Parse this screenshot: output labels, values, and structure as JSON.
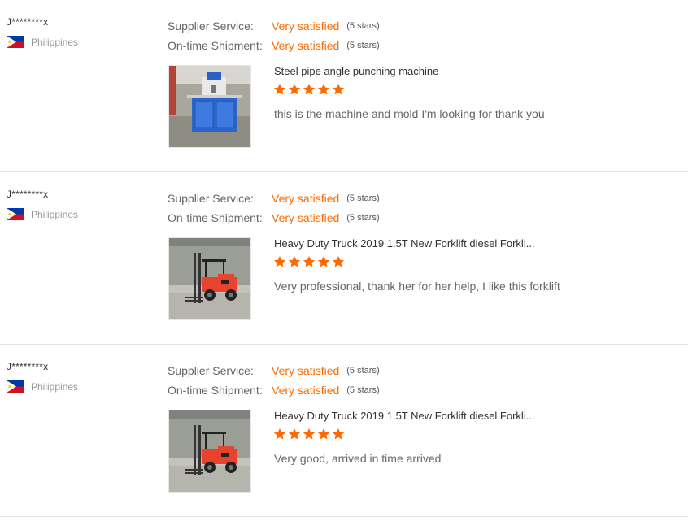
{
  "reviews": [
    {
      "user": "J********x",
      "country": "Philippines",
      "supplier_service_label": "Supplier Service:",
      "supplier_service_value": "Very satisfied",
      "supplier_service_stars": "(5 stars)",
      "shipment_label": "On-time Shipment:",
      "shipment_value": "Very satisfied",
      "shipment_stars": "(5 stars)",
      "product_title": "Steel pipe angle punching machine",
      "rating": 5,
      "comment": "this is the machine and mold I'm looking for thank you",
      "image": "punching-machine"
    },
    {
      "user": "J********x",
      "country": "Philippines",
      "supplier_service_label": "Supplier Service:",
      "supplier_service_value": "Very satisfied",
      "supplier_service_stars": "(5 stars)",
      "shipment_label": "On-time Shipment:",
      "shipment_value": "Very satisfied",
      "shipment_stars": "(5 stars)",
      "product_title": "Heavy Duty Truck 2019 1.5T New Forklift diesel Forkli...",
      "rating": 5,
      "comment": "Very professional, thank her for her help, I like this forklift",
      "image": "forklift"
    },
    {
      "user": "J********x",
      "country": "Philippines",
      "supplier_service_label": "Supplier Service:",
      "supplier_service_value": "Very satisfied",
      "supplier_service_stars": "(5 stars)",
      "shipment_label": "On-time Shipment:",
      "shipment_value": "Very satisfied",
      "shipment_stars": "(5 stars)",
      "product_title": "Heavy Duty Truck 2019 1.5T New Forklift diesel Forkli...",
      "rating": 5,
      "comment": "Very good, arrived in time arrived",
      "image": "forklift"
    }
  ],
  "colors": {
    "accent": "#ff6a00",
    "label": "#666666",
    "muted": "#999999",
    "divider": "#e2e2e2"
  },
  "icons": {
    "flag": "philippines-flag-icon",
    "star": "star-icon"
  }
}
